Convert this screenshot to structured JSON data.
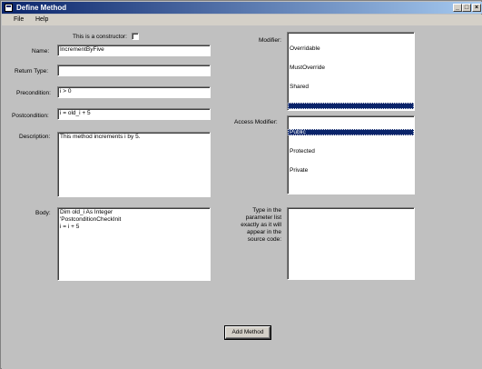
{
  "window": {
    "title": "Define Method",
    "minimize": "_",
    "maximize": "□",
    "close": "×"
  },
  "menu": {
    "file": "File",
    "help": "Help"
  },
  "form": {
    "constructor_label": "This is a constructor:",
    "constructor_checked": false,
    "name_label": "Name:",
    "name_value": "IncrementByFive",
    "return_type_label": "Return Type:",
    "return_type_value": "",
    "precondition_label": "Precondition:",
    "precondition_value": "i > 0",
    "postcondition_label": "Postcondition:",
    "postcondition_value": "i = old_i + 5",
    "description_label": "Description:",
    "description_value": "This method increments i by 5.",
    "body_label": "Body:",
    "body_value": "Dim old_i As Integer\n'PostconditionCheckInit\ni = i + 5"
  },
  "modifier": {
    "label": "Modifier:",
    "items": [
      "Overridable",
      "MustOverride",
      "Shared",
      ""
    ],
    "selected_index": 3
  },
  "access_modifier": {
    "label": "Access Modifier:",
    "items": [
      "Public",
      "Protected",
      "Private"
    ],
    "selected_index": 0
  },
  "parameters": {
    "hint": "Type in the\nparameter list\nexactly as it will\nappear in the\nsource code:",
    "value": ""
  },
  "add_method_button": "Add Method"
}
